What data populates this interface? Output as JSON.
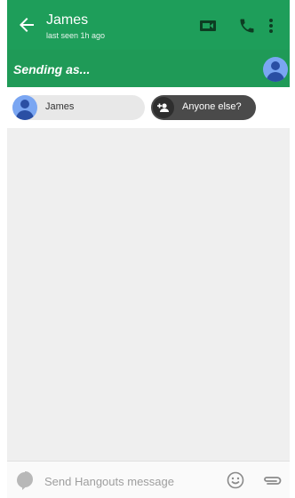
{
  "header": {
    "contact_name": "James",
    "status": "last seen 1h ago",
    "icons": [
      "back-arrow-icon",
      "video-call-icon",
      "phone-call-icon",
      "more-options-icon"
    ],
    "color": "#1e9e5a"
  },
  "sending_as": {
    "label": "Sending as...",
    "avatar_icon": "account-avatar-icon"
  },
  "recipients": {
    "selected_chip": "James",
    "add_chip": "Anyone else?",
    "add_icon": "add-person-icon"
  },
  "composer": {
    "placeholder": "Send Hangouts message",
    "icons": [
      "chat-bubble-icon",
      "emoji-icon",
      "attachment-icon"
    ]
  }
}
